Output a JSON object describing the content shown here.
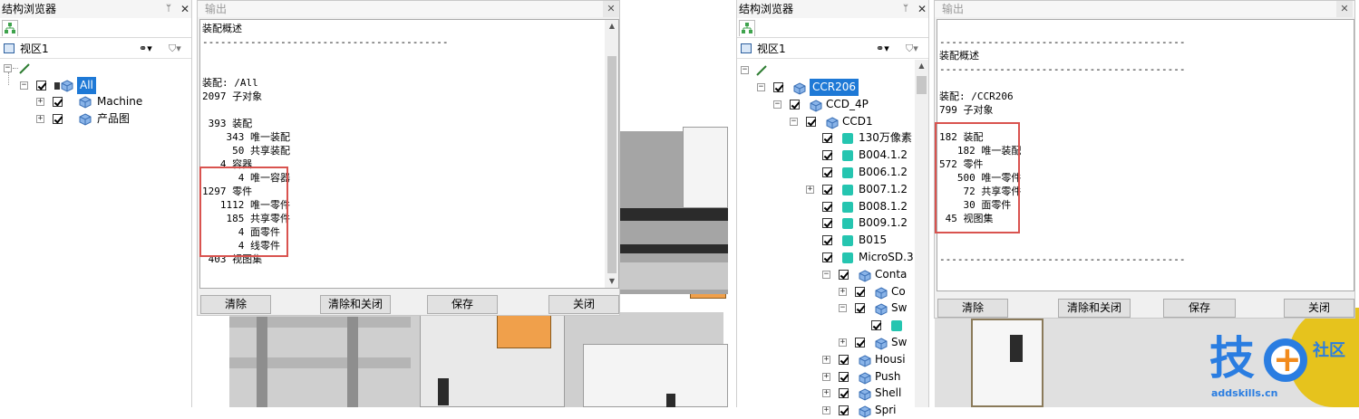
{
  "left_panel": {
    "title": "结构浏览器",
    "pin": "ᛘ",
    "close": "✕",
    "view_label": "视区1",
    "tree": [
      {
        "label": "All",
        "selected": true
      },
      {
        "label": "Machine"
      },
      {
        "label": "产品图"
      }
    ]
  },
  "output1": {
    "title": "输出",
    "close": "✕",
    "lines": [
      "装配概述",
      "-----------------------------------------",
      "",
      "",
      "装配: /All",
      "2097 子对象",
      "",
      " 393 装配",
      "    343 唯一装配",
      "     50 共享装配",
      "   4 容器",
      "      4 唯一容器",
      "1297 零件",
      "   1112 唯一零件",
      "    185 共享零件",
      "      4 面零件",
      "      4 线零件",
      " 403 视图集",
      "",
      "",
      "-----------------------------------------"
    ],
    "buttons": [
      "清除",
      "清除和关闭",
      "保存",
      "关闭"
    ]
  },
  "right_panel": {
    "title": "结构浏览器",
    "pin": "ᛘ",
    "close": "✕",
    "view_label": "视区1",
    "tree": [
      {
        "label": "CCR206",
        "selected": true
      },
      {
        "label": "CCD_4P"
      },
      {
        "label": "CCD1"
      },
      {
        "label": "130万像素"
      },
      {
        "label": "B004.1.2"
      },
      {
        "label": "B006.1.2"
      },
      {
        "label": "B007.1.2"
      },
      {
        "label": "B008.1.2"
      },
      {
        "label": "B009.1.2"
      },
      {
        "label": "B015"
      },
      {
        "label": "MicroSD.3"
      },
      {
        "label": "Conta"
      },
      {
        "label": "Co"
      },
      {
        "label": "Sw"
      },
      {
        "label": ""
      },
      {
        "label": "Sw"
      },
      {
        "label": "Housi"
      },
      {
        "label": "Push"
      },
      {
        "label": "Shell"
      },
      {
        "label": "Spri"
      }
    ]
  },
  "output2": {
    "title": "输出",
    "close": "✕",
    "lines": [
      "",
      "-----------------------------------------",
      "装配概述",
      "-----------------------------------------",
      "",
      "装配: /CCR206",
      "799 子对象",
      "",
      "182 装配",
      "   182 唯一装配",
      "572 零件",
      "   500 唯一零件",
      "    72 共享零件",
      "    30 面零件",
      " 45 视图集",
      "",
      "",
      "-----------------------------------------"
    ],
    "buttons": [
      "清除",
      "清除和关闭",
      "保存",
      "关闭"
    ]
  },
  "logo": {
    "text": "技",
    "sub": "社区",
    "url": "addskills.cn"
  },
  "colors": {
    "selection": "#1e79d6",
    "highlight_box": "#d9534f",
    "part_teal": "#25c5b0"
  }
}
